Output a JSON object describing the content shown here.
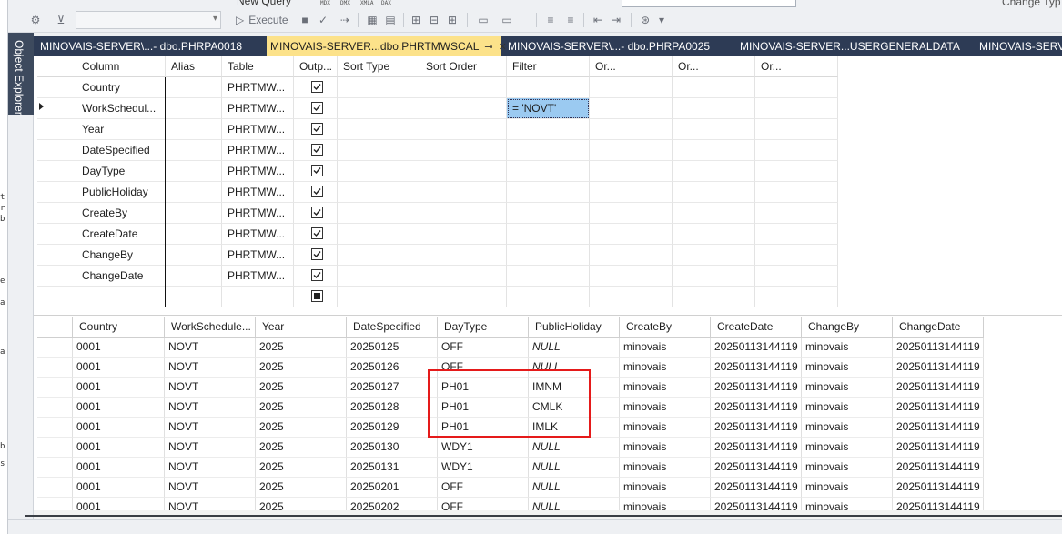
{
  "toolbar": {
    "new_query_label": "New Query",
    "execute_label": "Execute",
    "change_type_label": "Change Typ",
    "small_labels": [
      "MDX",
      "DMX",
      "XMLA",
      "DAX"
    ]
  },
  "object_explorer": {
    "label": "Object Explorer"
  },
  "tabs": [
    {
      "label": "MINOVAIS-SERVER\\...- dbo.PHRPA0018",
      "active": false
    },
    {
      "label": "MINOVAIS-SERVER...dbo.PHRTMWSCAL",
      "active": true
    },
    {
      "label": "MINOVAIS-SERVER\\...- dbo.PHRPA0025",
      "active": false
    },
    {
      "label": "MINOVAIS-SERVER...USERGENERALDATA",
      "active": false
    },
    {
      "label": "MINOVAIS-SERVER",
      "active": false
    }
  ],
  "criteria": {
    "headers": [
      "Column",
      "Alias",
      "Table",
      "Outp...",
      "Sort Type",
      "Sort Order",
      "Filter",
      "Or...",
      "Or...",
      "Or..."
    ],
    "rows": [
      {
        "column": "Country",
        "alias": "",
        "table": "PHRTMW...",
        "output": true,
        "filter": ""
      },
      {
        "column": "WorkSchedul...",
        "alias": "",
        "table": "PHRTMW...",
        "output": true,
        "filter": "= 'NOVT'"
      },
      {
        "column": "Year",
        "alias": "",
        "table": "PHRTMW...",
        "output": true,
        "filter": ""
      },
      {
        "column": "DateSpecified",
        "alias": "",
        "table": "PHRTMW...",
        "output": true,
        "filter": ""
      },
      {
        "column": "DayType",
        "alias": "",
        "table": "PHRTMW...",
        "output": true,
        "filter": ""
      },
      {
        "column": "PublicHoliday",
        "alias": "",
        "table": "PHRTMW...",
        "output": true,
        "filter": ""
      },
      {
        "column": "CreateBy",
        "alias": "",
        "table": "PHRTMW...",
        "output": true,
        "filter": ""
      },
      {
        "column": "CreateDate",
        "alias": "",
        "table": "PHRTMW...",
        "output": true,
        "filter": ""
      },
      {
        "column": "ChangeBy",
        "alias": "",
        "table": "PHRTMW...",
        "output": true,
        "filter": ""
      },
      {
        "column": "ChangeDate",
        "alias": "",
        "table": "PHRTMW...",
        "output": true,
        "filter": ""
      }
    ]
  },
  "results": {
    "headers": [
      "Country",
      "WorkSchedule...",
      "Year",
      "DateSpecified",
      "DayType",
      "PublicHoliday",
      "CreateBy",
      "CreateDate",
      "ChangeBy",
      "ChangeDate"
    ],
    "rows": [
      [
        "0001",
        "NOVT",
        "2025",
        "20250125",
        "OFF",
        "NULL",
        "minovais",
        "20250113144119",
        "minovais",
        "20250113144119"
      ],
      [
        "0001",
        "NOVT",
        "2025",
        "20250126",
        "OFF",
        "NULL",
        "minovais",
        "20250113144119",
        "minovais",
        "20250113144119"
      ],
      [
        "0001",
        "NOVT",
        "2025",
        "20250127",
        "PH01",
        "IMNM",
        "minovais",
        "20250113144119",
        "minovais",
        "20250113144119"
      ],
      [
        "0001",
        "NOVT",
        "2025",
        "20250128",
        "PH01",
        "CMLK",
        "minovais",
        "20250113144119",
        "minovais",
        "20250113144119"
      ],
      [
        "0001",
        "NOVT",
        "2025",
        "20250129",
        "PH01",
        "IMLK",
        "minovais",
        "20250113144119",
        "minovais",
        "20250113144119"
      ],
      [
        "0001",
        "NOVT",
        "2025",
        "20250130",
        "WDY1",
        "NULL",
        "minovais",
        "20250113144119",
        "minovais",
        "20250113144119"
      ],
      [
        "0001",
        "NOVT",
        "2025",
        "20250131",
        "WDY1",
        "NULL",
        "minovais",
        "20250113144119",
        "minovais",
        "20250113144119"
      ],
      [
        "0001",
        "NOVT",
        "2025",
        "20250201",
        "OFF",
        "NULL",
        "minovais",
        "20250113144119",
        "minovais",
        "20250113144119"
      ],
      [
        "0001",
        "NOVT",
        "2025",
        "20250202",
        "OFF",
        "NULL",
        "minovais",
        "20250113144119",
        "minovais",
        "20250113144119"
      ]
    ]
  },
  "colors": {
    "tab_strip": "#2d3b55",
    "active_tab": "#fce28a",
    "filter_selection": "#9bcaf1",
    "highlight_box": "#e51a1a"
  }
}
